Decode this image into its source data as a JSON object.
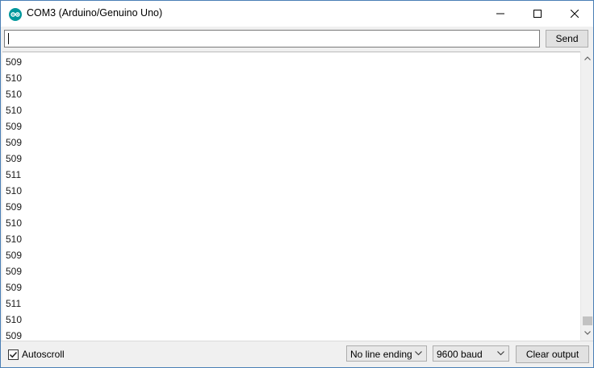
{
  "window": {
    "title": "COM3 (Arduino/Genuino Uno)",
    "app_icon": "arduino-icon",
    "controls": [
      "minimize-icon",
      "maximize-icon",
      "close-icon"
    ]
  },
  "input": {
    "value": "",
    "send_label": "Send"
  },
  "output": {
    "lines": [
      "509",
      "510",
      "510",
      "510",
      "509",
      "509",
      "509",
      "511",
      "510",
      "509",
      "510",
      "510",
      "509",
      "509",
      "509",
      "511",
      "510",
      "509"
    ]
  },
  "footer": {
    "autoscroll_label": "Autoscroll",
    "autoscroll_checked": true,
    "line_ending": "No line ending",
    "baud": "9600 baud",
    "clear_label": "Clear output"
  },
  "colors": {
    "arduino_teal": "#00979c",
    "window_border": "#4a7fb5"
  }
}
